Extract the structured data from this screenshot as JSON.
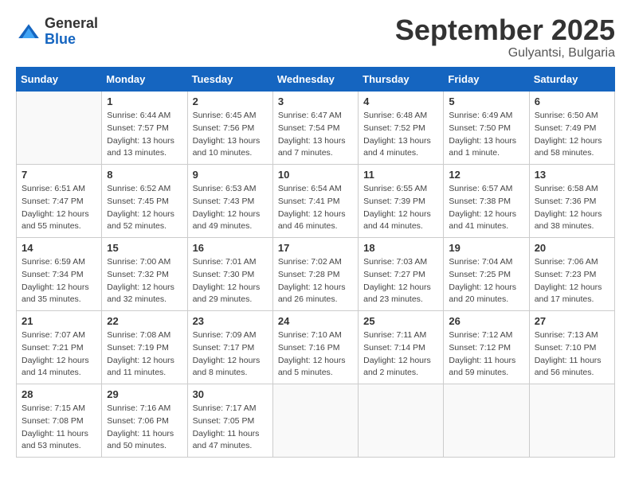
{
  "logo": {
    "general": "General",
    "blue": "Blue"
  },
  "header": {
    "month": "September 2025",
    "location": "Gulyantsi, Bulgaria"
  },
  "weekdays": [
    "Sunday",
    "Monday",
    "Tuesday",
    "Wednesday",
    "Thursday",
    "Friday",
    "Saturday"
  ],
  "weeks": [
    [
      {
        "day": null
      },
      {
        "day": 1,
        "sunrise": "6:44 AM",
        "sunset": "7:57 PM",
        "daylight": "13 hours and 13 minutes."
      },
      {
        "day": 2,
        "sunrise": "6:45 AM",
        "sunset": "7:56 PM",
        "daylight": "13 hours and 10 minutes."
      },
      {
        "day": 3,
        "sunrise": "6:47 AM",
        "sunset": "7:54 PM",
        "daylight": "13 hours and 7 minutes."
      },
      {
        "day": 4,
        "sunrise": "6:48 AM",
        "sunset": "7:52 PM",
        "daylight": "13 hours and 4 minutes."
      },
      {
        "day": 5,
        "sunrise": "6:49 AM",
        "sunset": "7:50 PM",
        "daylight": "13 hours and 1 minute."
      },
      {
        "day": 6,
        "sunrise": "6:50 AM",
        "sunset": "7:49 PM",
        "daylight": "12 hours and 58 minutes."
      }
    ],
    [
      {
        "day": 7,
        "sunrise": "6:51 AM",
        "sunset": "7:47 PM",
        "daylight": "12 hours and 55 minutes."
      },
      {
        "day": 8,
        "sunrise": "6:52 AM",
        "sunset": "7:45 PM",
        "daylight": "12 hours and 52 minutes."
      },
      {
        "day": 9,
        "sunrise": "6:53 AM",
        "sunset": "7:43 PM",
        "daylight": "12 hours and 49 minutes."
      },
      {
        "day": 10,
        "sunrise": "6:54 AM",
        "sunset": "7:41 PM",
        "daylight": "12 hours and 46 minutes."
      },
      {
        "day": 11,
        "sunrise": "6:55 AM",
        "sunset": "7:39 PM",
        "daylight": "12 hours and 44 minutes."
      },
      {
        "day": 12,
        "sunrise": "6:57 AM",
        "sunset": "7:38 PM",
        "daylight": "12 hours and 41 minutes."
      },
      {
        "day": 13,
        "sunrise": "6:58 AM",
        "sunset": "7:36 PM",
        "daylight": "12 hours and 38 minutes."
      }
    ],
    [
      {
        "day": 14,
        "sunrise": "6:59 AM",
        "sunset": "7:34 PM",
        "daylight": "12 hours and 35 minutes."
      },
      {
        "day": 15,
        "sunrise": "7:00 AM",
        "sunset": "7:32 PM",
        "daylight": "12 hours and 32 minutes."
      },
      {
        "day": 16,
        "sunrise": "7:01 AM",
        "sunset": "7:30 PM",
        "daylight": "12 hours and 29 minutes."
      },
      {
        "day": 17,
        "sunrise": "7:02 AM",
        "sunset": "7:28 PM",
        "daylight": "12 hours and 26 minutes."
      },
      {
        "day": 18,
        "sunrise": "7:03 AM",
        "sunset": "7:27 PM",
        "daylight": "12 hours and 23 minutes."
      },
      {
        "day": 19,
        "sunrise": "7:04 AM",
        "sunset": "7:25 PM",
        "daylight": "12 hours and 20 minutes."
      },
      {
        "day": 20,
        "sunrise": "7:06 AM",
        "sunset": "7:23 PM",
        "daylight": "12 hours and 17 minutes."
      }
    ],
    [
      {
        "day": 21,
        "sunrise": "7:07 AM",
        "sunset": "7:21 PM",
        "daylight": "12 hours and 14 minutes."
      },
      {
        "day": 22,
        "sunrise": "7:08 AM",
        "sunset": "7:19 PM",
        "daylight": "12 hours and 11 minutes."
      },
      {
        "day": 23,
        "sunrise": "7:09 AM",
        "sunset": "7:17 PM",
        "daylight": "12 hours and 8 minutes."
      },
      {
        "day": 24,
        "sunrise": "7:10 AM",
        "sunset": "7:16 PM",
        "daylight": "12 hours and 5 minutes."
      },
      {
        "day": 25,
        "sunrise": "7:11 AM",
        "sunset": "7:14 PM",
        "daylight": "12 hours and 2 minutes."
      },
      {
        "day": 26,
        "sunrise": "7:12 AM",
        "sunset": "7:12 PM",
        "daylight": "11 hours and 59 minutes."
      },
      {
        "day": 27,
        "sunrise": "7:13 AM",
        "sunset": "7:10 PM",
        "daylight": "11 hours and 56 minutes."
      }
    ],
    [
      {
        "day": 28,
        "sunrise": "7:15 AM",
        "sunset": "7:08 PM",
        "daylight": "11 hours and 53 minutes."
      },
      {
        "day": 29,
        "sunrise": "7:16 AM",
        "sunset": "7:06 PM",
        "daylight": "11 hours and 50 minutes."
      },
      {
        "day": 30,
        "sunrise": "7:17 AM",
        "sunset": "7:05 PM",
        "daylight": "11 hours and 47 minutes."
      },
      {
        "day": null
      },
      {
        "day": null
      },
      {
        "day": null
      },
      {
        "day": null
      }
    ]
  ]
}
